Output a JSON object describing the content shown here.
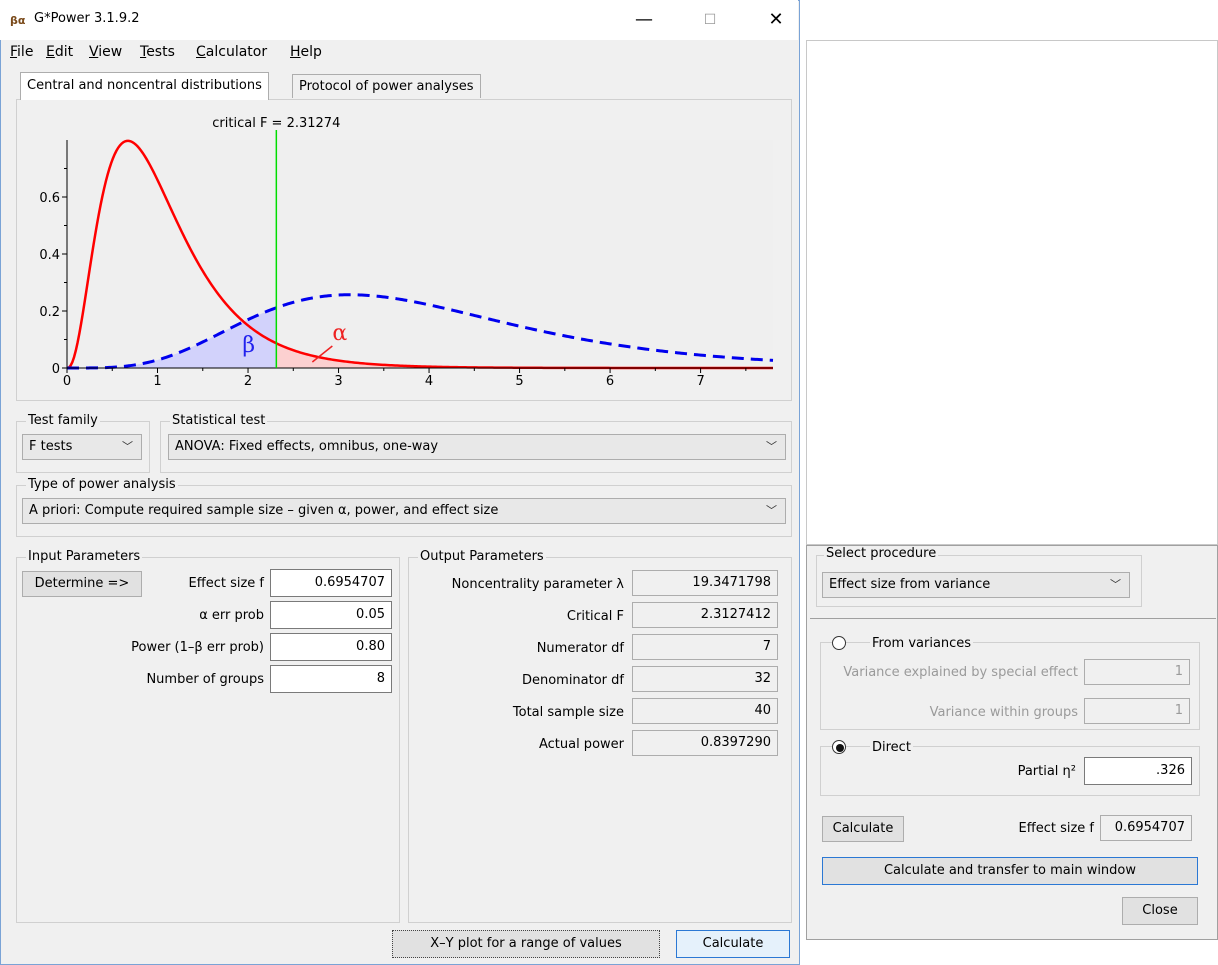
{
  "window": {
    "title": "G*Power 3.1.9.2",
    "logo": "βα",
    "minimize": "—",
    "maximize": "☐",
    "close": "✕"
  },
  "menu": [
    {
      "u": "F",
      "rest": "ile"
    },
    {
      "u": "E",
      "rest": "dit"
    },
    {
      "u": "V",
      "rest": "iew"
    },
    {
      "u": "T",
      "rest": "ests"
    },
    {
      "u": "C",
      "rest": "alculator"
    },
    {
      "u": "H",
      "rest": "elp"
    }
  ],
  "tabs": {
    "distributions": "Central and noncentral distributions",
    "protocol": "Protocol of power analyses"
  },
  "chart_data": {
    "type": "line",
    "title": "critical F = 2.31274",
    "critical_f": 2.31274,
    "xlim": [
      0,
      7.8
    ],
    "ylim": [
      0,
      0.8
    ],
    "x_ticks": [
      "0",
      "1",
      "2",
      "3",
      "4",
      "5",
      "6",
      "7"
    ],
    "y_ticks": [
      "0",
      "0.2",
      "0.4",
      "0.6"
    ],
    "series": [
      {
        "name": "central F",
        "dist": {
          "d1": 7,
          "d2": 32
        },
        "color": "#ff0000",
        "style": "solid"
      },
      {
        "name": "noncentral F",
        "dist": {
          "d1": 7,
          "d2": 32,
          "lambda": 19.3471798
        },
        "color": "#0000ee",
        "style": "dashed"
      }
    ],
    "annotations": {
      "beta": "β",
      "alpha": "α"
    },
    "colors": {
      "beta_fill": "#c8c8ff",
      "alpha_fill": "#ffc8c8",
      "critical_line": "#00dd00"
    }
  },
  "test_family": {
    "label": "Test family",
    "value": "F tests"
  },
  "statistical_test": {
    "label": "Statistical test",
    "value": "ANOVA: Fixed effects, omnibus, one-way"
  },
  "power_analysis": {
    "label": "Type of power analysis",
    "value": "A priori: Compute required sample size – given α, power, and effect size"
  },
  "input": {
    "label": "Input Parameters",
    "determine": "Determine =>",
    "rows": [
      {
        "label": "Effect size f",
        "value": "0.6954707"
      },
      {
        "label": "α err prob",
        "value": "0.05"
      },
      {
        "label": "Power (1–β err prob)",
        "value": "0.80"
      },
      {
        "label": "Number of groups",
        "value": "8"
      }
    ]
  },
  "output": {
    "label": "Output Parameters",
    "rows": [
      {
        "label": "Noncentrality parameter λ",
        "value": "19.3471798"
      },
      {
        "label": "Critical F",
        "value": "2.3127412"
      },
      {
        "label": "Numerator df",
        "value": "7"
      },
      {
        "label": "Denominator df",
        "value": "32"
      },
      {
        "label": "Total sample size",
        "value": "40"
      },
      {
        "label": "Actual power",
        "value": "0.8397290"
      }
    ]
  },
  "bottom": {
    "xy_plot": "X–Y plot for a range of values",
    "calculate": "Calculate"
  },
  "side": {
    "select_label": "Select procedure",
    "procedure": "Effect size from variance",
    "from_variances": "From variances",
    "var_special_label": "Variance explained by special effect",
    "var_special_value": "1",
    "var_within_label": "Variance within groups",
    "var_within_value": "1",
    "direct": "Direct",
    "partial_eta_label": "Partial η²",
    "partial_eta_value": ".326",
    "calculate": "Calculate",
    "effect_size_label": "Effect size f",
    "effect_size_value": "0.6954707",
    "transfer": "Calculate and transfer to main window",
    "close": "Close"
  }
}
